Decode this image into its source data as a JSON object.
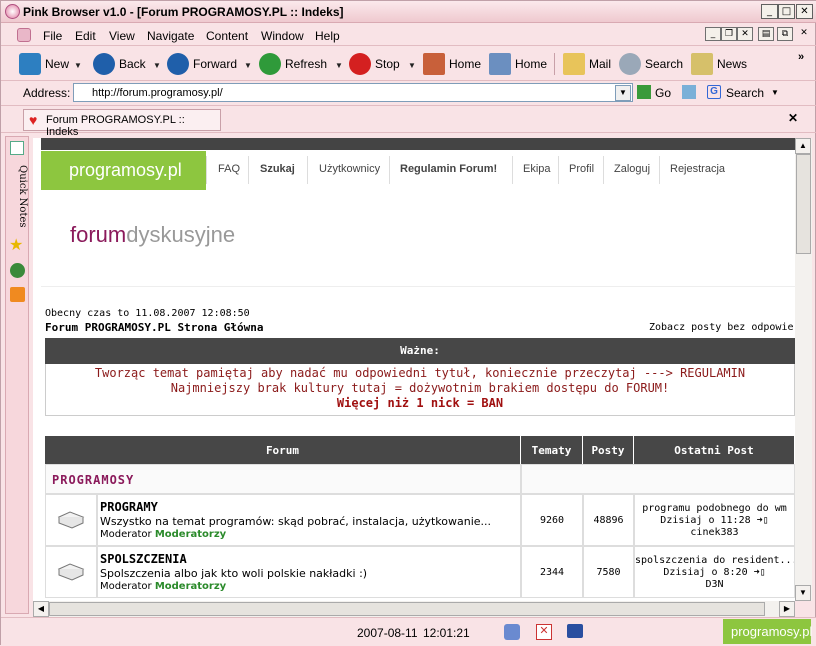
{
  "window": {
    "title": "Pink Browser v1.0 - [Forum PROGRAMOSY.PL :: Indeks]"
  },
  "menu": [
    "File",
    "Edit",
    "View",
    "Navigate",
    "Content",
    "Window",
    "Help"
  ],
  "toolbar": {
    "new": "New",
    "back": "Back",
    "forward": "Forward",
    "refresh": "Refresh",
    "stop": "Stop",
    "home1": "Home",
    "home2": "Home",
    "mail": "Mail",
    "search": "Search",
    "news": "News"
  },
  "address": {
    "label": "Address:",
    "url": "http://forum.programosy.pl/",
    "go": "Go",
    "search": "Search"
  },
  "tab": {
    "label": "Forum PROGRAMOSY.PL :: Indeks"
  },
  "sidebar": {
    "quick_notes": "Quick Notes"
  },
  "page": {
    "logo": "programosy.pl",
    "nav": [
      "FAQ",
      "Szukaj",
      "Użytkownicy",
      "Regulamin Forum!",
      "Ekipa",
      "Profil",
      "Zaloguj",
      "Rejestracja"
    ],
    "banner_bold": "forum",
    "banner_rest": "dyskusyjne",
    "time": "Obecny czas to 11.08.2007 12:08:50",
    "home": "Forum PROGRAMOSY.PL Strona Główna",
    "see_posts": "Zobacz posty bez odpowie",
    "important_title": "Ważne:",
    "important_1": "Tworząc temat pamiętaj aby nadać mu odpowiedni tytuł, koniecznie przeczytaj ---> REGULAMIN",
    "important_2": "Najmniejszy brak kultury tutaj = dożywotnim brakiem dostępu do FORUM!",
    "important_3": "Więcej niż 1 nick = BAN",
    "headers": {
      "forum": "Forum",
      "topics": "Tematy",
      "posts": "Posty",
      "last": "Ostatni Post"
    },
    "category": "PROGRAMOSY",
    "forums": [
      {
        "name": "PROGRAMY",
        "desc": "Wszystko na temat programów: skąd pobrać, instalacja, użytkowanie...",
        "mod_label": "Moderator",
        "mod": "Moderatorzy",
        "topics": "9260",
        "posts": "48896",
        "last_title": "programu podobnego do wm",
        "last_date": "Dzisiaj o 11:28",
        "last_user": "cinek383"
      },
      {
        "name": "SPOLSZCZENIA",
        "desc": "Spolszczenia albo jak kto woli polskie nakładki :)",
        "mod_label": "Moderator",
        "mod": "Moderatorzy",
        "topics": "2344",
        "posts": "7580",
        "last_title": "spolszczenia do resident...",
        "last_date": "Dzisiaj o 8:20",
        "last_user": "D3N"
      }
    ]
  },
  "status": {
    "date": "2007-08-11",
    "time": "12:01:21",
    "logo": "programosy.pl"
  }
}
